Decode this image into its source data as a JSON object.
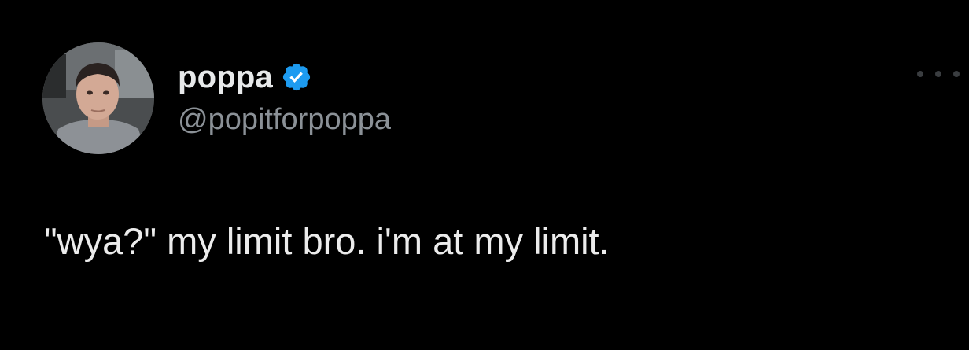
{
  "tweet": {
    "display_name": "poppa",
    "handle": "@popitforpoppa",
    "verified": true,
    "text": "\"wya?\" my limit bro. i'm at my limit."
  },
  "icons": {
    "verified": "verified-badge-icon",
    "more": "more-options-icon",
    "avatar": "profile-photo"
  },
  "colors": {
    "background": "#000000",
    "name": "#e7e9ea",
    "handle": "#8b9197",
    "verified": "#1d9bf0"
  }
}
